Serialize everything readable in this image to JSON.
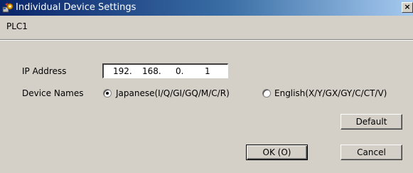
{
  "window": {
    "title": "Individual Device Settings",
    "close_glyph": "×"
  },
  "device": {
    "name": "PLC1"
  },
  "ip": {
    "label": "IP Address",
    "octets": [
      "192.",
      "168.",
      "0.",
      "1"
    ]
  },
  "device_names": {
    "label": "Device Names",
    "options": [
      {
        "label": "Japanese(I/Q/GI/GQ/M/C/R)",
        "selected": true
      },
      {
        "label": "English(X/Y/GX/GY/C/CT/V)",
        "selected": false
      }
    ]
  },
  "buttons": {
    "default_label": "Default",
    "ok_label": "OK (O)",
    "cancel_label": "Cancel"
  },
  "colors": {
    "face": "#d4d0c8",
    "titlebar_start": "#0a246a",
    "titlebar_end": "#a6caf0"
  },
  "icons": {
    "title": "device-settings-icon"
  }
}
